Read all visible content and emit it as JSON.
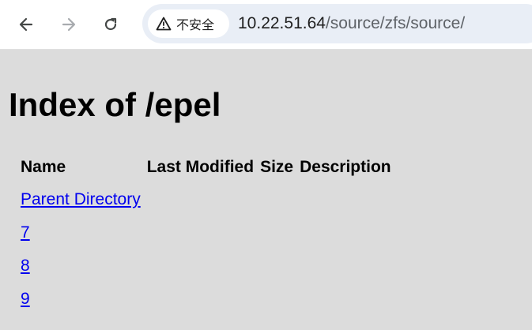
{
  "browser": {
    "nav": {
      "back_icon": "arrow-left-icon",
      "forward_icon": "arrow-right-icon",
      "reload_icon": "reload-icon"
    },
    "security_chip": {
      "icon": "warning-triangle-icon",
      "label": "不安全"
    },
    "url": {
      "host": "10.22.51.64",
      "path": "/source/zfs/source/"
    }
  },
  "page": {
    "title": "Index of /epel",
    "table": {
      "headers": [
        "Name",
        "Last Modified",
        "Size",
        "Description"
      ],
      "rows": [
        {
          "name": "Parent Directory",
          "last_modified": "",
          "size": "",
          "description": ""
        },
        {
          "name": "7",
          "last_modified": "",
          "size": "",
          "description": ""
        },
        {
          "name": "8",
          "last_modified": "",
          "size": "",
          "description": ""
        },
        {
          "name": "9",
          "last_modified": "",
          "size": "",
          "description": ""
        }
      ]
    }
  },
  "colors": {
    "page_background": "#dcdcdc",
    "link": "#0000ee",
    "omnibox": "#e9eef6"
  }
}
